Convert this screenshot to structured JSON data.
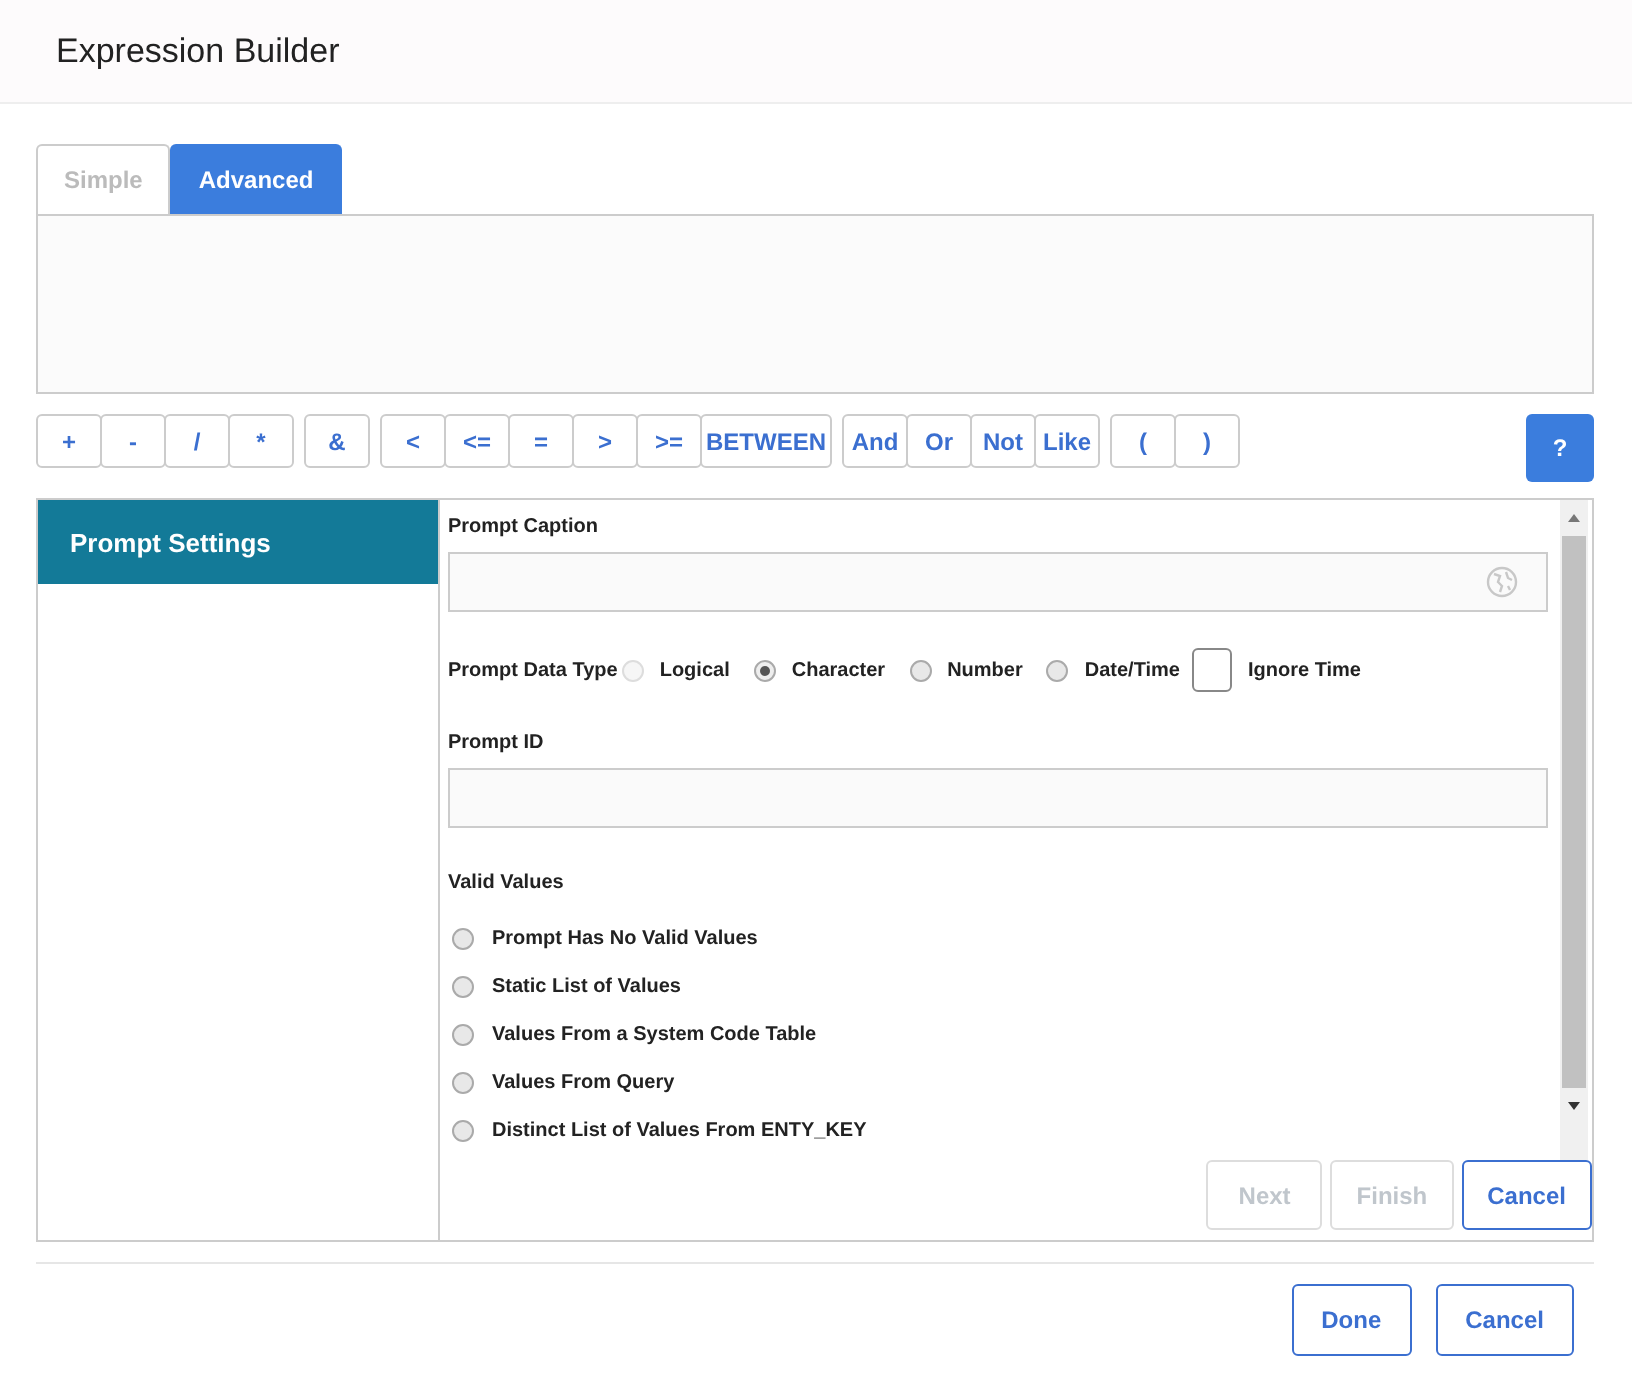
{
  "window": {
    "title": "Expression Builder"
  },
  "tabs": [
    {
      "label": "Simple",
      "selected": false
    },
    {
      "label": "Advanced",
      "selected": true
    }
  ],
  "operator_groups": [
    [
      "+",
      "-",
      "/",
      "*"
    ],
    [
      "&"
    ],
    [
      "<",
      "<=",
      "=",
      ">",
      ">=",
      "BETWEEN"
    ],
    [
      "And",
      "Or",
      "Not",
      "Like"
    ],
    [
      "(",
      ")"
    ]
  ],
  "help_button": "?",
  "sidebar": {
    "items": [
      {
        "label": "Prompt Settings",
        "selected": true
      }
    ]
  },
  "form": {
    "caption_label": "Prompt Caption",
    "data_type_label": "Prompt Data Type",
    "data_types": [
      {
        "kind": "radio",
        "label": "Logical",
        "selected": false,
        "disabled": true
      },
      {
        "kind": "radio",
        "label": "Character",
        "selected": true,
        "disabled": false
      },
      {
        "kind": "radio",
        "label": "Number",
        "selected": false,
        "disabled": false
      },
      {
        "kind": "radio",
        "label": "Date/Time",
        "selected": false,
        "disabled": false
      },
      {
        "kind": "checkbox",
        "label": "Ignore Time",
        "checked": false
      }
    ],
    "id_label": "Prompt ID",
    "valid_values_label": "Valid Values",
    "valid_values": [
      {
        "label": "Prompt Has No Valid Values",
        "selected": false
      },
      {
        "label": "Static List of Values",
        "selected": false
      },
      {
        "label": "Values From a System Code Table",
        "selected": false
      },
      {
        "label": "Values From Query",
        "selected": false
      },
      {
        "label": "Distinct List of Values From ENTY_KEY",
        "selected": false
      }
    ]
  },
  "wizard_buttons": [
    {
      "label": "Next",
      "disabled": true
    },
    {
      "label": "Finish",
      "disabled": true
    },
    {
      "label": "Cancel",
      "disabled": false
    }
  ],
  "footer_buttons": [
    "Done",
    "Cancel"
  ]
}
